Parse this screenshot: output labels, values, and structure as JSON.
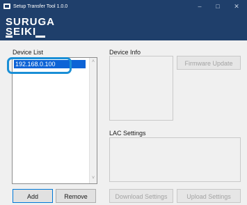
{
  "window": {
    "title": "Setup Transfer Tool 1.0.0",
    "minimize_glyph": "–",
    "maximize_glyph": "□",
    "close_glyph": "✕"
  },
  "logo": {
    "line1": "SURUGA",
    "line2": "SEIKI"
  },
  "device_list": {
    "label": "Device List",
    "items": [
      "192.168.0.100"
    ],
    "selected_index": 0,
    "scroll_up_glyph": "˄",
    "scroll_down_glyph": "˅"
  },
  "device_info": {
    "label": "Device Info",
    "firmware_update_label": "Firmware Update"
  },
  "lac_settings": {
    "label": "LAC Settings",
    "download_label": "Download Settings",
    "upload_label": "Upload Settings"
  },
  "buttons": {
    "add_label": "Add",
    "remove_label": "Remove"
  },
  "colors": {
    "brand": "#1f3f6b",
    "selection": "#0d63d6",
    "highlight": "#1a8fd6"
  }
}
